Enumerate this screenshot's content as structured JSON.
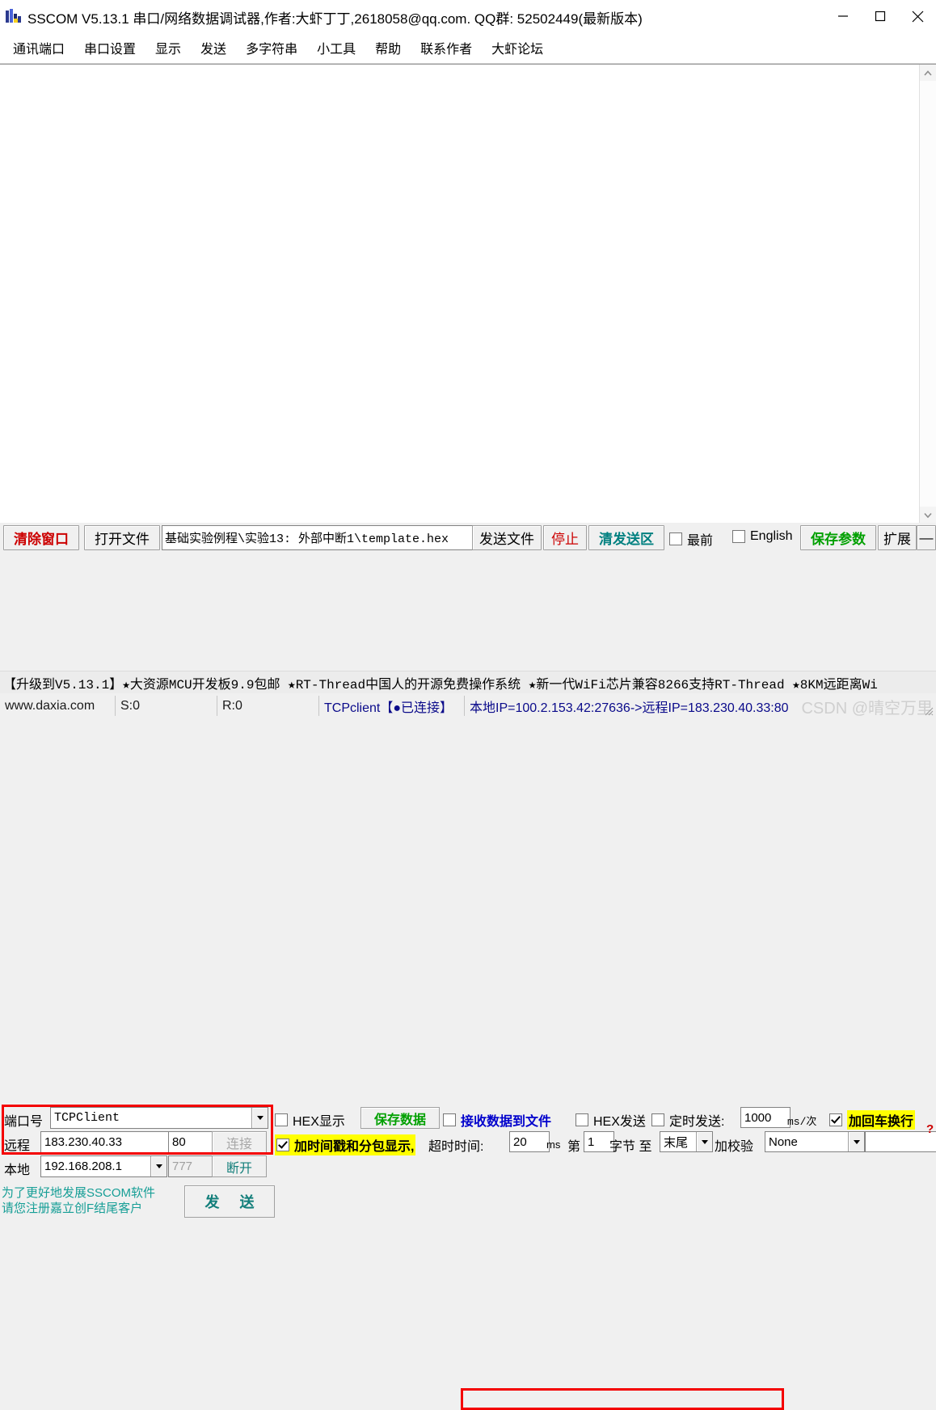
{
  "window": {
    "title": "SSCOM V5.13.1 串口/网络数据调试器,作者:大虾丁丁,2618058@qq.com. QQ群: 52502449(最新版本)",
    "icon": "sscom-app-icon",
    "minimize": "—",
    "maximize": "▢",
    "close": "✕"
  },
  "menu": {
    "items": [
      {
        "label": "通讯端口"
      },
      {
        "label": "串口设置"
      },
      {
        "label": "显示"
      },
      {
        "label": "发送"
      },
      {
        "label": "多字符串"
      },
      {
        "label": "小工具"
      },
      {
        "label": "帮助"
      },
      {
        "label": "联系作者"
      },
      {
        "label": "大虾论坛"
      }
    ]
  },
  "receive_area": {
    "content": "",
    "scrollbar": {
      "up": "⌃",
      "down": "⌄"
    }
  },
  "toolbar": {
    "clear_window": "清除窗口",
    "open_file": "打开文件",
    "file_path": "基础实验例程\\实验13: 外部中断1\\template.hex",
    "send_file": "发送文件",
    "stop": "停止",
    "clear_send": "清发送区",
    "topmost_label": "最前",
    "topmost_checked": false,
    "english_label": "English",
    "english_checked": false,
    "save_params": "保存参数",
    "extend": "扩展",
    "minus": "—"
  },
  "settings": {
    "port_label": "端口号",
    "port_value": "TCPClient",
    "remote_label": "远程",
    "remote_ip": "183.230.40.33",
    "remote_port": "80",
    "connect_button": "连接",
    "local_label": "本地",
    "local_ip": "192.168.208.1",
    "local_port": "777",
    "disconnect_button": "断开",
    "hex_display_label": "HEX显示",
    "hex_display_checked": false,
    "save_data_button": "保存数据",
    "recv_to_file_label": "接收数据到文件",
    "recv_to_file_checked": false,
    "timestamp_label": "加时间戳和分包显示,",
    "timestamp_checked": true,
    "timeout_label": "超时时间:",
    "timeout_value": "20",
    "timeout_unit": "ms",
    "byte_prefix": "第",
    "byte_start": "1",
    "byte_mid": "字节 至",
    "byte_end": "末尾",
    "checksum_label": "加校验",
    "checksum_value": "None",
    "checksum_extra": "",
    "hex_send_label": "HEX发送",
    "hex_send_checked": false,
    "timed_send_label": "定时发送:",
    "timed_send_checked": false,
    "timed_send_value": "1000",
    "timed_send_unit": "ms/次",
    "crlf_label": "加回车换行",
    "crlf_checked": true,
    "help_mark": "?",
    "register_note_line1": "为了更好地发展SSCOM软件",
    "register_note_line2": "请您注册嘉立创F结尾客户",
    "send_button": "发 送"
  },
  "ad_bar": {
    "text": "【升级到V5.13.1】★大资源MCU开发板9.9包邮 ★RT-Thread中国人的开源免费操作系统 ★新一代WiFi芯片兼容8266支持RT-Thread ★8KM远距离Wi"
  },
  "status_bar": {
    "website": "www.daxia.com",
    "sent": "S:0",
    "received": "R:0",
    "connection": "TCPclient【●已连接】",
    "ip_info": "本地IP=100.2.153.42:27636->远程IP=183.230.40.33:80",
    "watermark": "CSDN @晴空万里"
  },
  "colors": {
    "accent_red": "#cc0000",
    "accent_green": "#00a000",
    "accent_teal": "#127e7a",
    "accent_blue": "#0000cc",
    "highlight_yellow": "#ffff00",
    "highlight_box": "#f40000"
  }
}
